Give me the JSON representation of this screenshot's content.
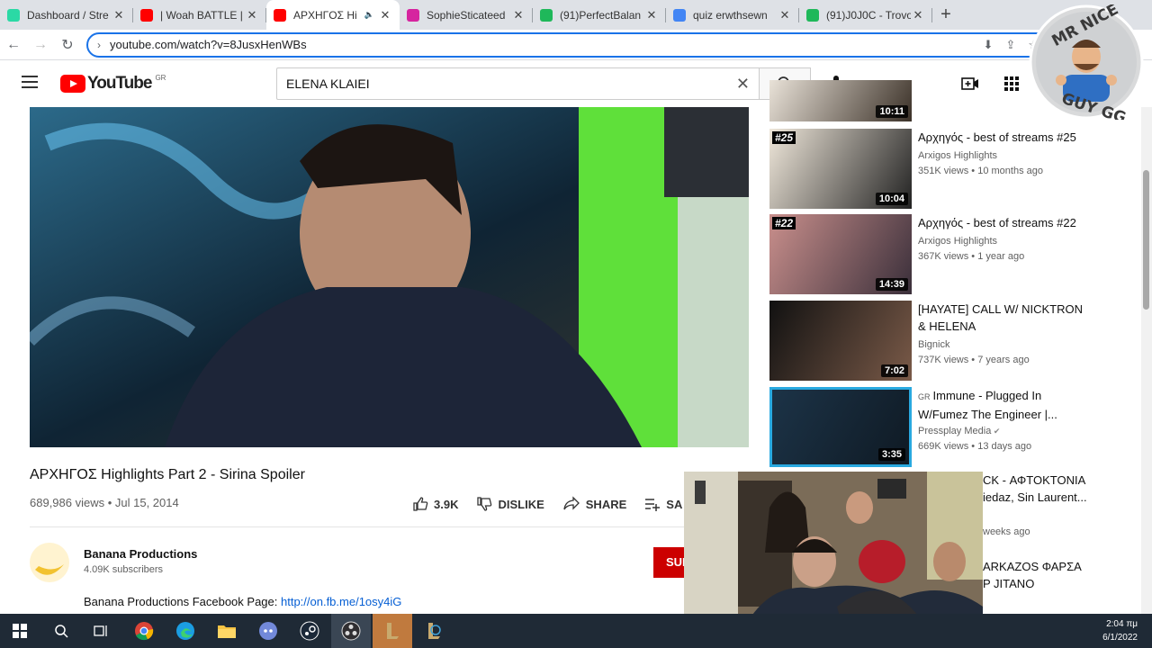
{
  "browser": {
    "tabs": [
      {
        "title": "Dashboard / Stre",
        "fav_color": "#2bd9a5"
      },
      {
        "title": "| Woah BATTLE |",
        "fav_color": "#ff0000"
      },
      {
        "title": "ΑΡΧΗΓΟΣ Hi",
        "fav_color": "#ff0000",
        "active": true
      },
      {
        "title": "SophieSticateed",
        "fav_color": "#d6249f"
      },
      {
        "title": "(91)PerfectBalan",
        "fav_color": "#1fb85a"
      },
      {
        "title": "quiz erwthsewn",
        "fav_color": "#4285f4"
      },
      {
        "title": "(91)J0J0C - Trovo",
        "fav_color": "#1fb85a"
      }
    ],
    "url": "youtube.com/watch?v=8JusxHenWBs"
  },
  "youtube": {
    "logo_text": "YouTube",
    "region": "GR",
    "search_value": "ELENA KLAIEI"
  },
  "video": {
    "title": "ΑΡΧΗΓΟΣ Highlights Part 2 - Sirina Spoiler",
    "meta": "689,986 views • Jul 15, 2014",
    "likes": "3.9K",
    "dislike_label": "DISLIKE",
    "share_label": "SHARE",
    "save_label": "SA",
    "channel": "Banana Productions",
    "subscribers": "4.09K subscribers",
    "subscribe_label": "SUB",
    "desc_text": "Banana Productions Facebook Page: ",
    "desc_link": "http://on.fb.me/1osy4iG"
  },
  "recommendations": [
    {
      "duration": "10:11"
    },
    {
      "title": "Αρχηγός - best of streams #25",
      "channel": "Arxigos Highlights",
      "views": "351K views • 10 months ago",
      "duration": "10:04",
      "badge_num": "#25"
    },
    {
      "title": "Αρχηγός - best of streams #22",
      "channel": "Arxigos Highlights",
      "views": "367K views • 1 year ago",
      "duration": "14:39",
      "badge_num": "#22"
    },
    {
      "title": "[HAYATE] CALL W/ NICKTRON & HELENA",
      "channel": "Bignick",
      "views": "737K views • 7 years ago",
      "duration": "7:02"
    },
    {
      "title": "Immune - Plugged In W/Fumez The Engineer |...",
      "prefix": "GR",
      "channel": "Pressplay Media",
      "views": "669K views • 13 days ago",
      "duration": "3:35"
    }
  ],
  "partials": [
    {
      "line1": "CK - ΑΦΤΟΚΤΟΝΙΑ",
      "line2": "iedaz, Sin Laurent...",
      "line3": "weeks ago"
    },
    {
      "line1": "ARKAZOS ΦΑΡΣΑ",
      "line2": "P JITANO"
    }
  ],
  "logo_badge": {
    "line1": "MR NICE",
    "line2": "GUY GG"
  },
  "taskbar": {
    "time": "2:04 πμ",
    "date": "6/1/2022"
  }
}
